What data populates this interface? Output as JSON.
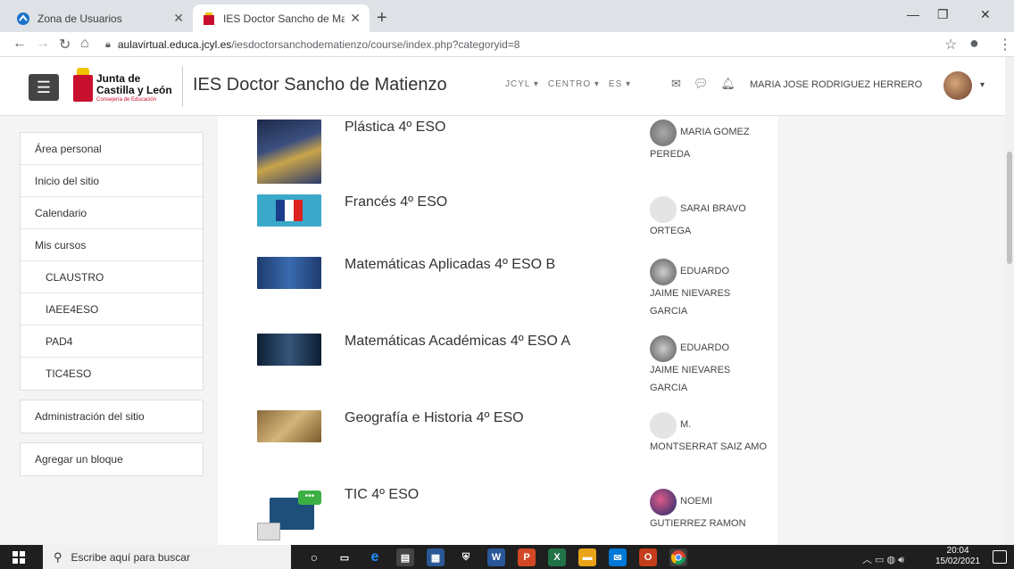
{
  "browser": {
    "tabs": [
      {
        "label": "Zona de Usuarios",
        "active": false
      },
      {
        "label": "IES Doctor Sancho de Matienzo",
        "active": true
      }
    ],
    "new_tab": "+",
    "url_host": "aulavirtual.educa.jcyl.es",
    "url_path": "/iesdoctorsanchodematienzo/course/index.php?categoryid=8"
  },
  "header": {
    "logo_line1": "Junta de",
    "logo_line2": "Castilla y León",
    "logo_line3": "Consejería de Educación",
    "site_name": "IES Doctor Sancho de Matienzo",
    "menu": [
      "JCYL ▾",
      "CENTRO ▾",
      "ES ▾"
    ],
    "user_name": "MARIA JOSE RODRIGUEZ HERRERO"
  },
  "sidebar": {
    "nav": [
      {
        "label": "Área personal",
        "sub": false
      },
      {
        "label": "Inicio del sitio",
        "sub": false
      },
      {
        "label": "Calendario",
        "sub": false
      },
      {
        "label": "Mis cursos",
        "sub": false
      },
      {
        "label": "CLAUSTRO",
        "sub": true
      },
      {
        "label": "IAEE4ESO",
        "sub": true
      },
      {
        "label": "PAD4",
        "sub": true
      },
      {
        "label": "TIC4ESO",
        "sub": true
      }
    ],
    "admin": "Administración del sitio",
    "add_block": "Agregar un bloque"
  },
  "courses": [
    {
      "name": "Plástica 4º ESO",
      "tutor_first": "MARIA GOMEZ",
      "tutor_rest": "PEREDA"
    },
    {
      "name": "Francés 4º ESO",
      "tutor_first": "SARAI BRAVO",
      "tutor_rest": "ORTEGA"
    },
    {
      "name": "Matemáticas Aplicadas 4º ESO B",
      "tutor_first": "EDUARDO",
      "tutor_rest": "JAIME NIEVARES GARCIA"
    },
    {
      "name": "Matemáticas Académicas 4º ESO A",
      "tutor_first": "EDUARDO",
      "tutor_rest": "JAIME NIEVARES GARCIA"
    },
    {
      "name": "Geografía e Historia 4º ESO",
      "tutor_first": "M.",
      "tutor_rest": "MONTSERRAT SAIZ AMO"
    },
    {
      "name": "TIC 4º ESO",
      "tutor_first": "NOEMI",
      "tutor_rest": "GUTIERREZ RAMON"
    }
  ],
  "taskbar": {
    "search_placeholder": "Escribe aquí para buscar",
    "time": "20:04",
    "date": "15/02/2021"
  },
  "colors": {
    "accent_red": "#c8102e",
    "header_bg": "#ffffff",
    "page_bg": "#f4f4f4"
  }
}
